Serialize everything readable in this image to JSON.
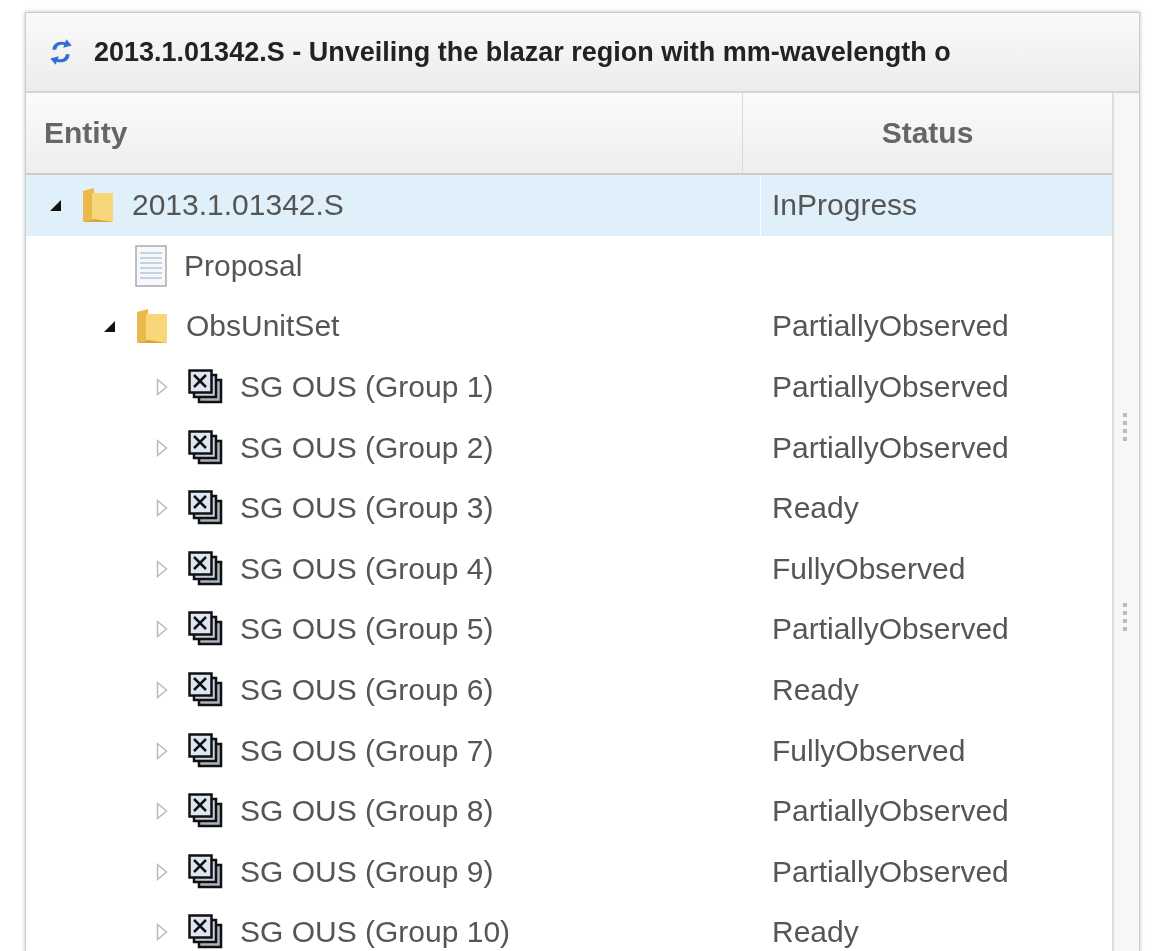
{
  "window": {
    "title": "2013.1.01342.S - Unveiling the blazar region with mm-wavelength o"
  },
  "table": {
    "columns": [
      "Entity",
      "Status"
    ],
    "tree": [
      {
        "kind": "folder",
        "label": "2013.1.01342.S",
        "status": "InProgress",
        "expanded": true,
        "selected": true,
        "children": [
          {
            "kind": "document",
            "label": "Proposal",
            "selected": false
          },
          {
            "kind": "folder",
            "label": "ObsUnitSet",
            "status": "PartiallyObserved",
            "expanded": true,
            "selected": false,
            "children": [
              {
                "kind": "group",
                "label": "SG OUS (Group 1)",
                "status": "PartiallyObserved",
                "expanded": false,
                "selected": false
              },
              {
                "kind": "group",
                "label": "SG OUS (Group 2)",
                "status": "PartiallyObserved",
                "expanded": false,
                "selected": false
              },
              {
                "kind": "group",
                "label": "SG OUS (Group 3)",
                "status": "Ready",
                "expanded": false,
                "selected": false
              },
              {
                "kind": "group",
                "label": "SG OUS (Group 4)",
                "status": "FullyObserved",
                "expanded": false,
                "selected": false
              },
              {
                "kind": "group",
                "label": "SG OUS (Group 5)",
                "status": "PartiallyObserved",
                "expanded": false,
                "selected": false
              },
              {
                "kind": "group",
                "label": "SG OUS (Group 6)",
                "status": "Ready",
                "expanded": false,
                "selected": false
              },
              {
                "kind": "group",
                "label": "SG OUS (Group 7)",
                "status": "FullyObserved",
                "expanded": false,
                "selected": false
              },
              {
                "kind": "group",
                "label": "SG OUS (Group 8)",
                "status": "PartiallyObserved",
                "expanded": false,
                "selected": false
              },
              {
                "kind": "group",
                "label": "SG OUS (Group 9)",
                "status": "PartiallyObserved",
                "expanded": false,
                "selected": false
              },
              {
                "kind": "group",
                "label": "SG OUS (Group 10)",
                "status": "Ready",
                "expanded": false,
                "selected": false
              }
            ]
          }
        ]
      }
    ]
  }
}
